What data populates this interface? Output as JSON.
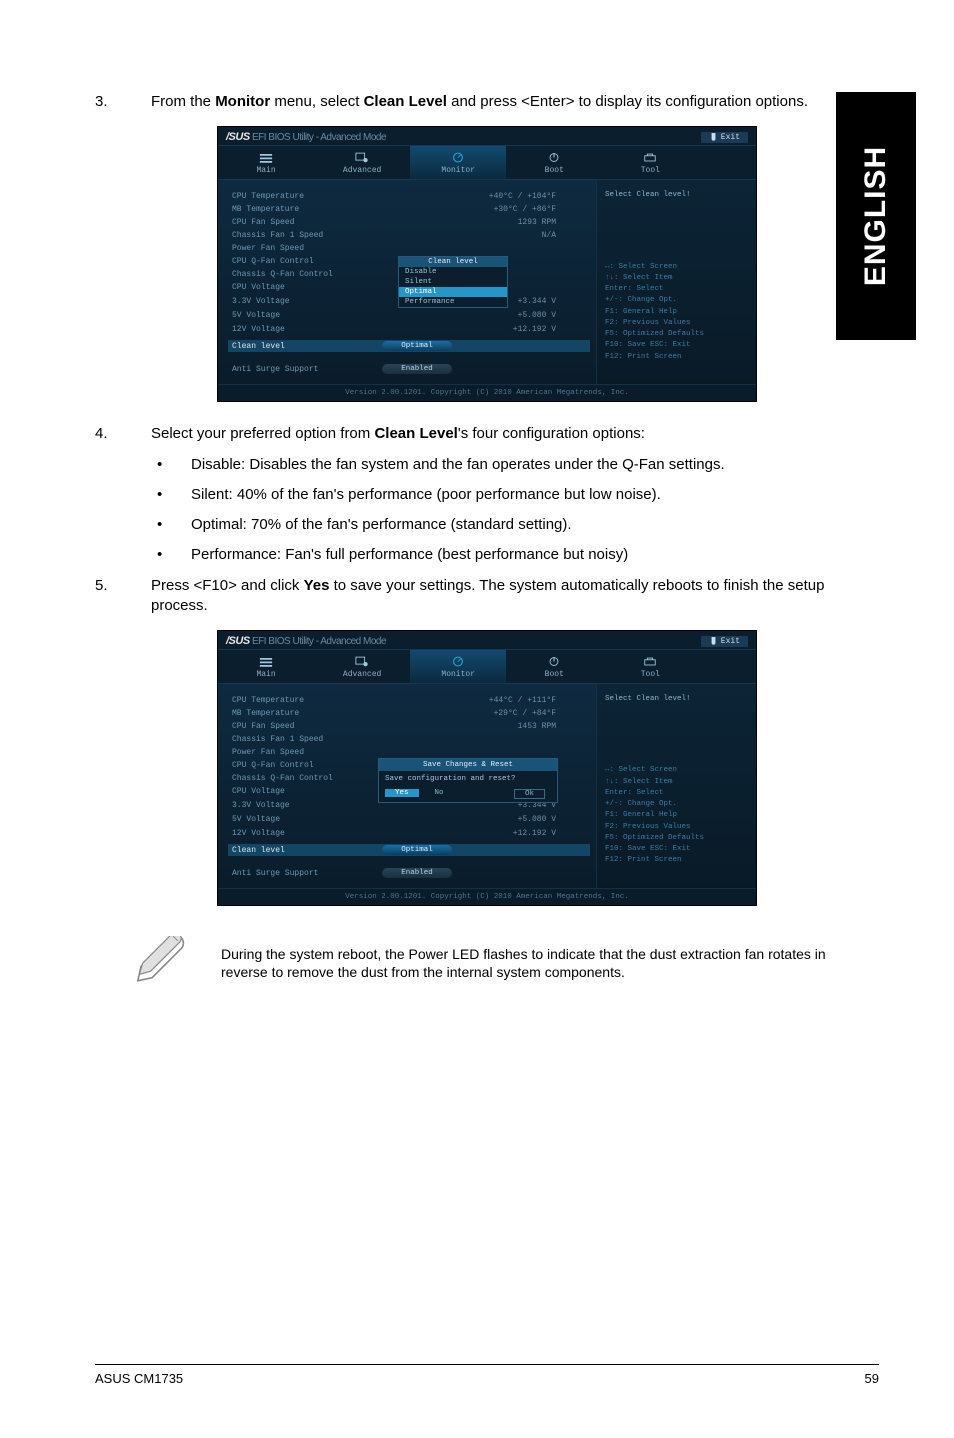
{
  "side_tab": "ENGLISH",
  "step3": {
    "num": "3.",
    "text_pre": "From the ",
    "b1": "Monitor",
    "text_mid": " menu, select ",
    "b2": "Clean Level",
    "text_post": " and press <Enter> to display its configuration options."
  },
  "step4": {
    "num": "4.",
    "text_pre": "Select your preferred option from ",
    "b1": "Clean Level",
    "text_post": "'s four configuration options:",
    "bullets": [
      "Disable: Disables the fan system and the fan operates under the Q-Fan settings.",
      "Silent: 40% of the fan's performance (poor performance but low noise).",
      "Optimal: 70% of the fan's performance (standard setting).",
      "Performance: Fan's full performance (best performance but noisy)"
    ]
  },
  "step5": {
    "num": "5.",
    "text_pre": "Press <F10> and click ",
    "b1": "Yes",
    "text_post": " to save your settings. The system automatically reboots to finish the setup process."
  },
  "bios_shared": {
    "logo_brand": "/SUS",
    "logo_sub": " EFI BIOS Utility - Advanced Mode",
    "exit": "Exit",
    "tabs": [
      "Main",
      "Advanced",
      "Monitor",
      "Boot",
      "Tool"
    ],
    "right_title": "Select Clean level!",
    "keys": [
      "↔: Select Screen",
      "↑↓: Select Item",
      "Enter: Select",
      "+/-: Change Opt.",
      "F1: General Help",
      "F2: Previous Values",
      "F5: Optimized Defaults",
      "F10: Save  ESC: Exit",
      "F12: Print Screen"
    ],
    "footer": "Version 2.00.1201. Copyright (C) 2010 American Megatrends, Inc."
  },
  "bios1": {
    "rows": [
      {
        "label": "CPU Temperature",
        "val": "+40°C / +104°F"
      },
      {
        "label": "MB Temperature",
        "val": "+30°C / +86°F"
      },
      {
        "label": "CPU Fan Speed",
        "val": "1293 RPM"
      },
      {
        "label": "Chassis Fan 1 Speed",
        "val": "N/A"
      },
      {
        "label": "Power Fan Speed",
        "val": ""
      },
      {
        "label": "CPU Q-Fan Control",
        "val": ""
      },
      {
        "label": "Chassis Q-Fan Control",
        "val": ""
      },
      {
        "label": "CPU Voltage",
        "val": ""
      },
      {
        "label": "3.3V Voltage",
        "val": "+3.344 V"
      },
      {
        "label": "5V Voltage",
        "val": "+5.080 V"
      },
      {
        "label": "12V Voltage",
        "val": "+12.192 V"
      },
      {
        "label": "Clean level",
        "val": "Optimal",
        "hl": true,
        "pill": "blue"
      },
      {
        "label": "Anti Surge Support",
        "val": "Enabled",
        "pill": "grey"
      }
    ],
    "popup": {
      "head": "Clean level",
      "items": [
        "Disable",
        "Silent",
        "Optimal",
        "Performance"
      ],
      "selected": 2
    }
  },
  "bios2": {
    "rows": [
      {
        "label": "CPU Temperature",
        "val": "+44°C / +111°F"
      },
      {
        "label": "MB Temperature",
        "val": "+29°C / +84°F"
      },
      {
        "label": "CPU Fan Speed",
        "val": "1453 RPM"
      },
      {
        "label": "Chassis Fan 1 Speed",
        "val": ""
      },
      {
        "label": "Power Fan Speed",
        "val": ""
      },
      {
        "label": "CPU Q-Fan Control",
        "val": ""
      },
      {
        "label": "Chassis Q-Fan Control",
        "val": ""
      },
      {
        "label": "CPU Voltage",
        "val": ""
      },
      {
        "label": "3.3V Voltage",
        "val": "+3.344 V"
      },
      {
        "label": "5V Voltage",
        "val": "+5.080 V"
      },
      {
        "label": "12V Voltage",
        "val": "+12.192 V"
      },
      {
        "label": "Clean level",
        "val": "Optimal",
        "hl": true,
        "pill": "blue"
      },
      {
        "label": "Anti Surge Support",
        "val": "Enabled",
        "pill": "grey"
      }
    ],
    "dialog": {
      "title": "Save Changes & Reset",
      "body": "Save configuration and reset?",
      "yes": "Yes",
      "no": "No",
      "ok": "Ok"
    }
  },
  "note": "During the system reboot, the Power LED flashes to indicate that the dust extraction fan rotates in reverse to remove the dust from the internal system components.",
  "footer": {
    "left": "ASUS CM1735",
    "right": "59"
  }
}
